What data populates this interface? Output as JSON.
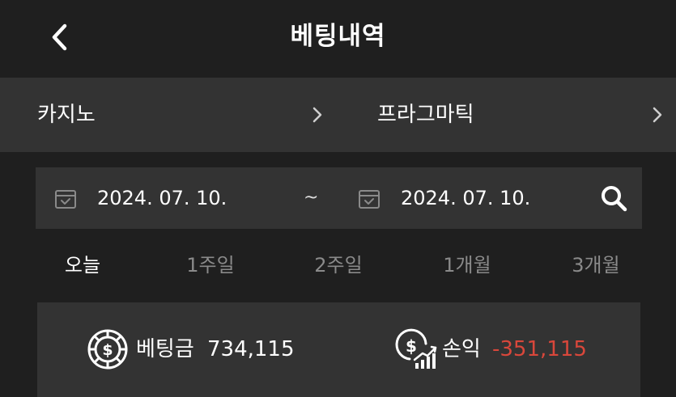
{
  "header": {
    "title": "베팅내역",
    "back_icon": "chevron-left-icon"
  },
  "category": {
    "game_type": "카지노",
    "provider": "프라그마틱"
  },
  "date_range": {
    "start": "2024. 07. 10.",
    "separator": "~",
    "end": "2024. 07. 10."
  },
  "period_tabs": [
    {
      "label": "오늘",
      "active": true
    },
    {
      "label": "1주일",
      "active": false
    },
    {
      "label": "2주일",
      "active": false
    },
    {
      "label": "1개월",
      "active": false
    },
    {
      "label": "3개월",
      "active": false
    }
  ],
  "summary": {
    "bet_label": "베팅금",
    "bet_value": "734,115",
    "profit_label": "손익",
    "profit_value": "-351,115"
  },
  "colors": {
    "background": "#1f1f1f",
    "panel": "#333333",
    "inactive_text": "#8a8a8a",
    "negative": "#d9473b"
  }
}
